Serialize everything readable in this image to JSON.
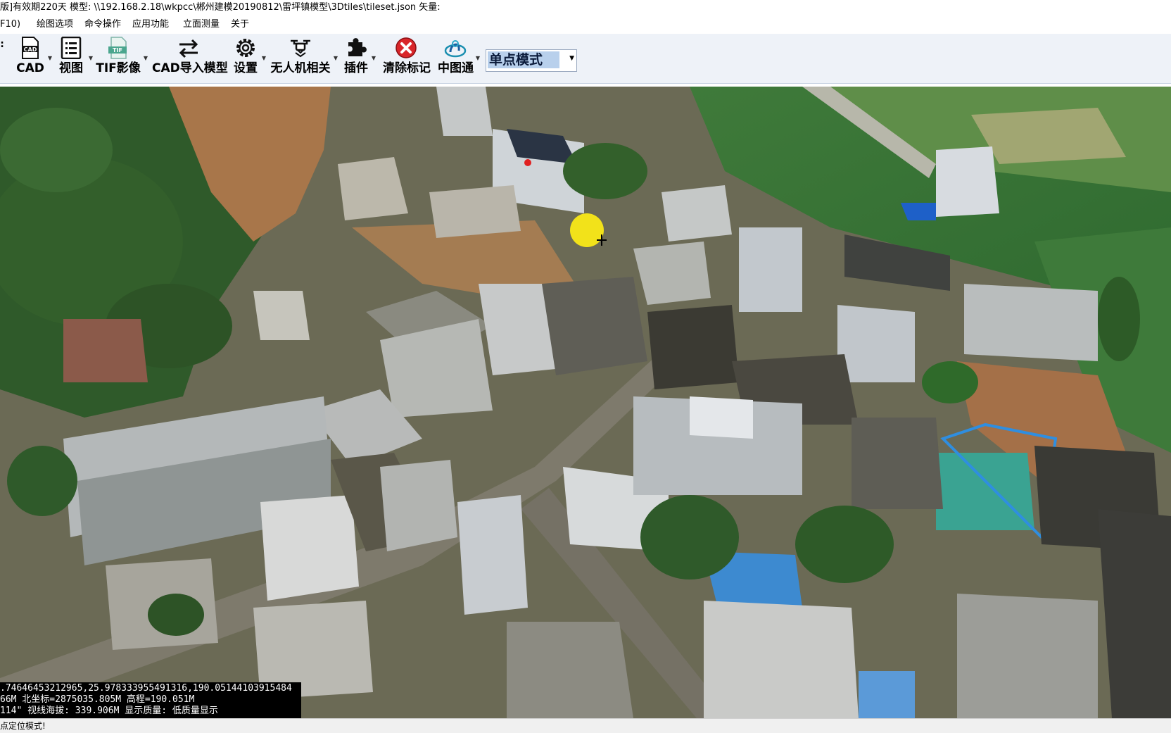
{
  "window": {
    "title": "版]有效期220天 模型: \\\\192.168.2.18\\wkpcc\\郴州建模20190812\\雷坪镇模型\\3Dtiles\\tileset.json 矢量:"
  },
  "menu": {
    "items": [
      "F10)",
      "绘图选项",
      "命令操作",
      "应用功能",
      "立面测量",
      "关于"
    ]
  },
  "toolbar": {
    "cad_label": "CAD",
    "view_label": "视图",
    "tif_label": "TIF影像",
    "cad_import_label": "CAD导入模型",
    "settings_label": "设置",
    "drone_label": "无人机相关",
    "plugin_label": "插件",
    "clear_label": "清除标记",
    "zhongtutong_label": "中图通",
    "mode_value": "单点模式",
    "cad_icon_text": "CAD",
    "tif_icon_text": "TIF"
  },
  "coords": {
    "line1": ".74646453212965,25.978333955491316,190.05144103915484",
    "line2": "66M  北坐标=2875035.805M  高程=190.051M",
    "line3": "114\"   视线海拔: 339.906M  显示质量: 低质量显示"
  },
  "status": {
    "text": "点定位模式!"
  },
  "colors": {
    "toolbar_bg": "#eef2f8",
    "mode_highlight": "#b8d0ec",
    "marker": "#f2e21a"
  }
}
